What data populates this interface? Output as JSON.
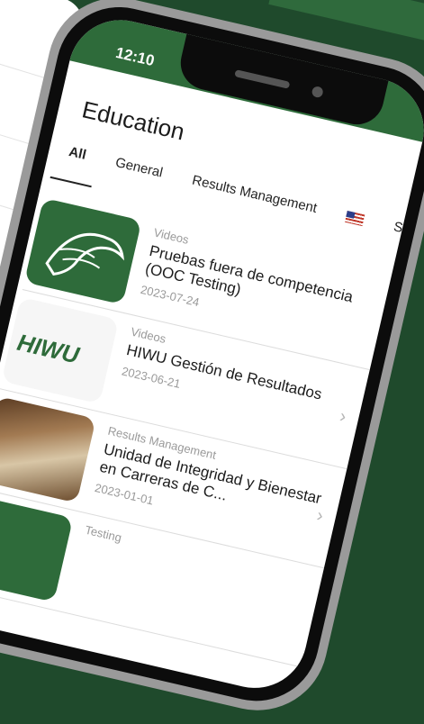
{
  "status": {
    "time": "12:10"
  },
  "page": {
    "title": "Education"
  },
  "tabs": [
    {
      "label": "All"
    },
    {
      "label": "General"
    },
    {
      "label": "Results Management"
    },
    {
      "label": "Sc"
    }
  ],
  "items": [
    {
      "category": "Videos",
      "name": "Pruebas fuera de competencia (OOC Testing)",
      "date": "2023-07-24",
      "thumb": "green"
    },
    {
      "category": "Videos",
      "name": "HIWU Gestión de Resultados",
      "date": "2023-06-21",
      "thumb": "white",
      "logo": "HIWU"
    },
    {
      "category": "Results Management",
      "name": "Unidad de Integridad y Bienestar en Carreras de C...",
      "date": "2023-01-01",
      "thumb": "photo"
    },
    {
      "category": "Testing",
      "name": "",
      "date": "",
      "thumb": "green"
    }
  ],
  "colors": {
    "brand": "#2e6b3a",
    "background": "#1f4a2c"
  }
}
